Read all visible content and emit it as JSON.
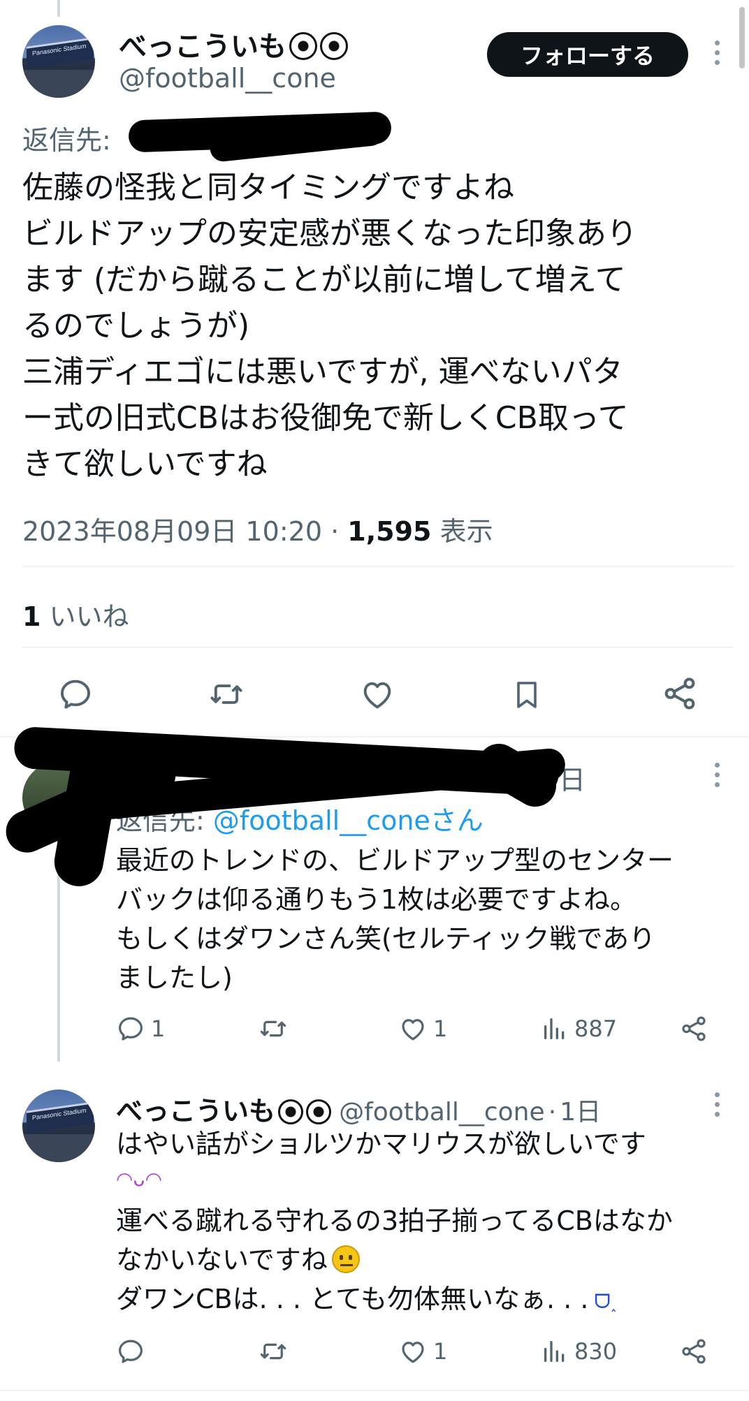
{
  "main_tweet": {
    "display_name": "べっこういも",
    "handle": "@football__cone",
    "follow_label": "フォローする",
    "reply_prefix": "返信先:",
    "text": "佐藤の怪我と同タイミングですよね\nビルドアップの安定感が悪くなった印象あり\nます (だから蹴ることが以前に増して増えて\nるのでしょうが)\n三浦ディエゴには悪いですが, 運べないパタ\nー式の旧式CBはお役御免で新しくCB取って\nきて欲しいですね",
    "timestamp": "2023年08月09日 10:20",
    "separator": "·",
    "views_count": "1,595",
    "views_label": "表示",
    "likes_count": "1",
    "likes_label": "いいね"
  },
  "reply_1": {
    "display_name_partial": "eac",
    "time_partial": "日",
    "reply_prefix": "返信先:",
    "reply_mention": "@football__coneさん",
    "text": "最近のトレンドの、ビルドアップ型のセンター\nバックは仰る通りもう1枚は必要ですよね。\nもしくはダワンさん笑(セルティック戦であり\nましたし)",
    "reply_count": "1",
    "like_count": "1",
    "view_count": "887"
  },
  "reply_2": {
    "display_name": "べっこういも",
    "handle": "@football__cone",
    "separator": "·",
    "time": "1日",
    "text_line1": "はやい話がショルツかマリウスが欲しいです",
    "text_rest": "運べる蹴れる守れるの3拍子揃ってるCBはなか\nなかいないですね",
    "text_line4": "ダワンCBは. . . とても勿体無いなぁ. . .",
    "like_count": "1",
    "view_count": "830"
  },
  "colors": {
    "text_primary": "#0f1419",
    "text_secondary": "#536471",
    "link": "#1d9bf0",
    "divider": "#eff3f4",
    "button_bg": "#0f1419"
  },
  "icons": [
    "reply-icon",
    "retweet-icon",
    "like-icon",
    "bookmark-icon",
    "share-icon",
    "views-icon",
    "more-icon",
    "soccer-ball-icon"
  ]
}
